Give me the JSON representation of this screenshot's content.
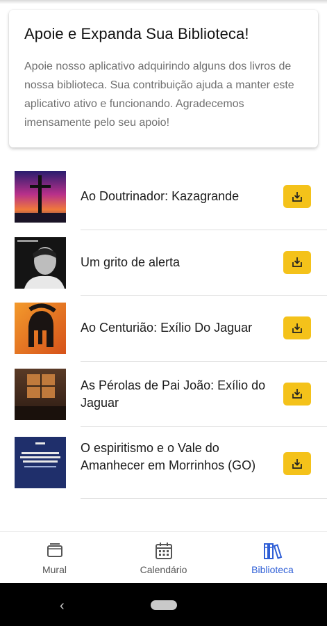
{
  "card": {
    "title": "Apoie e Expanda Sua Biblioteca!",
    "text": "Apoie nosso aplicativo adquirindo alguns dos livros de nossa biblioteca. Sua contribuição ajuda a manter este aplicativo ativo e funcionando. Agradecemos imensamente pelo seu apoio!"
  },
  "books": [
    {
      "title": "Ao Doutrinador: Kazagrande",
      "cover": "cross-sunset-cover"
    },
    {
      "title": "Um grito de alerta",
      "cover": "portrait-bw-cover"
    },
    {
      "title": "Ao Centurião: Exílio Do Jaguar",
      "cover": "helmet-orange-cover"
    },
    {
      "title": "As Pérolas de Pai João: Exílio do Jaguar",
      "cover": "dusk-window-cover"
    },
    {
      "title": "O espiritismo e o Vale do Amanhecer em Morrinhos (GO)",
      "cover": "blue-text-cover"
    }
  ],
  "colors": {
    "accent": "#f4c21a",
    "active_tab": "#2f5fd6"
  },
  "nav": {
    "tabs": [
      {
        "label": "Mural",
        "icon": "wallet-icon"
      },
      {
        "label": "Calendário",
        "icon": "calendar-icon"
      },
      {
        "label": "Biblioteca",
        "icon": "books-icon",
        "active": true
      }
    ]
  }
}
